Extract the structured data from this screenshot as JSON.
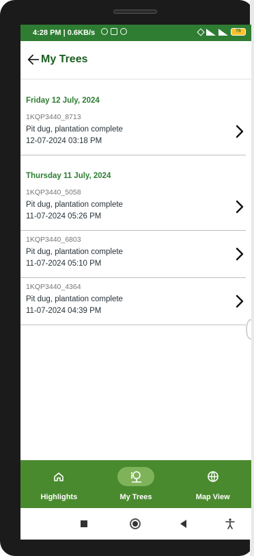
{
  "status_bar": {
    "time": "4:28 PM | 0.6KB/s",
    "battery": "76"
  },
  "header": {
    "title": "My Trees",
    "back_icon": "arrow-left-icon"
  },
  "groups": [
    {
      "date": "Friday 12 July, 2024",
      "records": [
        {
          "id": "1KQP3440_8713",
          "status": "Pit dug, plantation complete",
          "time": "12-07-2024 03:18 PM"
        }
      ]
    },
    {
      "date": "Thursday 11 July, 2024",
      "records": [
        {
          "id": "1KQP3440_5058",
          "status": "Pit dug, plantation complete",
          "time": "11-07-2024 05:26 PM"
        },
        {
          "id": "1KQP3440_6803",
          "status": "Pit dug, plantation complete",
          "time": "11-07-2024 05:10 PM"
        },
        {
          "id": "1KQP3440_4364",
          "status": "Pit dug, plantation complete",
          "time": "11-07-2024 04:39 PM"
        }
      ]
    }
  ],
  "bottom_nav": {
    "items": [
      {
        "label": "Highlights",
        "icon": "home-icon",
        "active": false
      },
      {
        "label": "My Trees",
        "icon": "tree-icon",
        "active": true
      },
      {
        "label": "Map View",
        "icon": "globe-icon",
        "active": false
      }
    ]
  },
  "colors": {
    "brand_green": "#2e7d32",
    "nav_green": "#4a8a2e",
    "nav_active": "#7fb35a"
  }
}
